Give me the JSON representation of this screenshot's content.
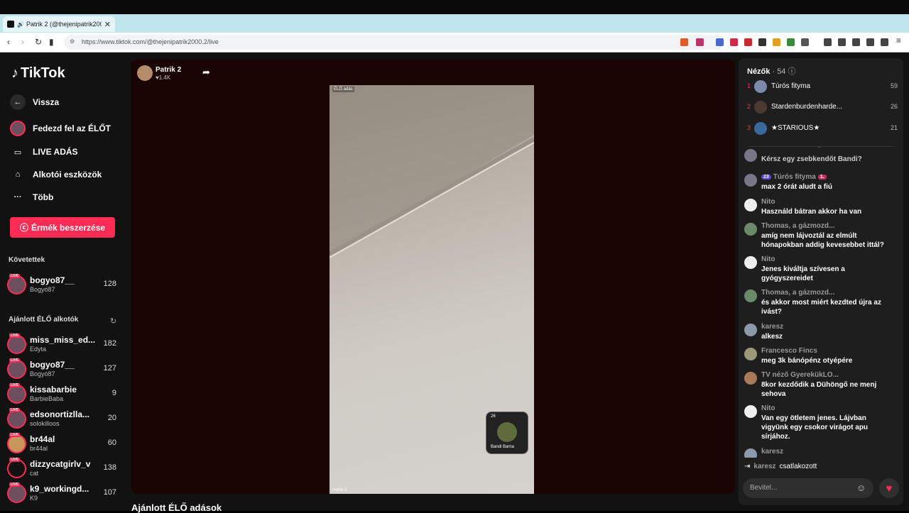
{
  "browser": {
    "tab_title": "Patrik 2 (@thejenipatrik2000...",
    "url": "https://www.tiktok.com/@thejenipatrik2000.2/live",
    "tab_close": "✕",
    "new_tab": "+"
  },
  "sidebar": {
    "logo": "TikTok",
    "nav": [
      {
        "label": "Vissza"
      },
      {
        "label": "Fedezd fel az ÉLŐT"
      },
      {
        "label": "LIVE ADÁS"
      },
      {
        "label": "Alkotói eszközök"
      },
      {
        "label": "Több"
      }
    ],
    "coins_label": "Érmék beszerzése",
    "following_title": "Követettek",
    "following": [
      {
        "name": "bogyo87__",
        "sub": "Bogyó87",
        "count": "128"
      }
    ],
    "recommended_title": "Ajánlott ÉLŐ alkotók",
    "recommended": [
      {
        "name": "miss_miss_ed...",
        "sub": "Edyta",
        "count": "182"
      },
      {
        "name": "bogyo87__",
        "sub": "Bogyó87",
        "count": "127"
      },
      {
        "name": "kissabarbie",
        "sub": "BarbieBaba",
        "count": "9"
      },
      {
        "name": "edsonortizlla...",
        "sub": "solokilloos",
        "count": "20"
      },
      {
        "name": "br44al",
        "sub": "br44al",
        "count": "60"
      },
      {
        "name": "dizzycatgirlv_v",
        "sub": "cat",
        "count": "138"
      },
      {
        "name": "k9_workingd...",
        "sub": "K9",
        "count": "107"
      }
    ],
    "live_badge": "LIVE"
  },
  "stream": {
    "host_name": "Patrik 2",
    "host_likes": "♥1.4K",
    "video_tag": "ÉLŐ adás",
    "video_footer": "Patrik 2",
    "gift_count": "26",
    "gift_name": "Bandi Barna",
    "recommended_title": "Ajánlott ÉLŐ adások"
  },
  "chat": {
    "viewers_title": "Nézők",
    "viewers_count": "· 54",
    "viewers": [
      {
        "rank": "1",
        "name": "Túrós fityma",
        "count": "59"
      },
      {
        "rank": "2",
        "name": "Stardenburdenharde...",
        "count": "26"
      },
      {
        "rank": "3",
        "name": "★STARIOUS★",
        "count": "21"
      }
    ],
    "messages": [
      {
        "name": "",
        "text": "Kérsz egy zsebkendőt Bandi?"
      },
      {
        "name": "Túrós fityma",
        "badge": "23",
        "badge2": "1.",
        "text": "max 2 órát aludt a fiú"
      },
      {
        "name": "Nito",
        "text": "Használd bátran akkor ha van"
      },
      {
        "name": "Thomas, a gázmozd...",
        "text": "amíg nem lájvoztál az elmúlt hónapokban addig kevesebbet ittál?"
      },
      {
        "name": "Nito",
        "text": "Jenes kiváltja szívesen a gyógyszereidet"
      },
      {
        "name": "Thomas, a gázmozd...",
        "text": "és akkor most miért kezdted újra az ivást?"
      },
      {
        "name": "karesz",
        "text": "alkesz"
      },
      {
        "name": "Francesco Fincs",
        "text": "meg 3k bánópénz otyépére"
      },
      {
        "name": "TV néző GyerekükLO...",
        "text": "8kor kezdődik a Dühöngő ne menj sehova"
      },
      {
        "name": "Nito",
        "text": "Van egy ötletem jenes. Lájvban vigyünk egy csokor virágot apu sírjához."
      },
      {
        "name": "karesz",
        "text": ""
      }
    ],
    "joined_name": "karesz",
    "joined_text": "csatlakozott",
    "input_placeholder": "Bevitel..."
  },
  "colors": {
    "accent": "#fe2c55"
  }
}
